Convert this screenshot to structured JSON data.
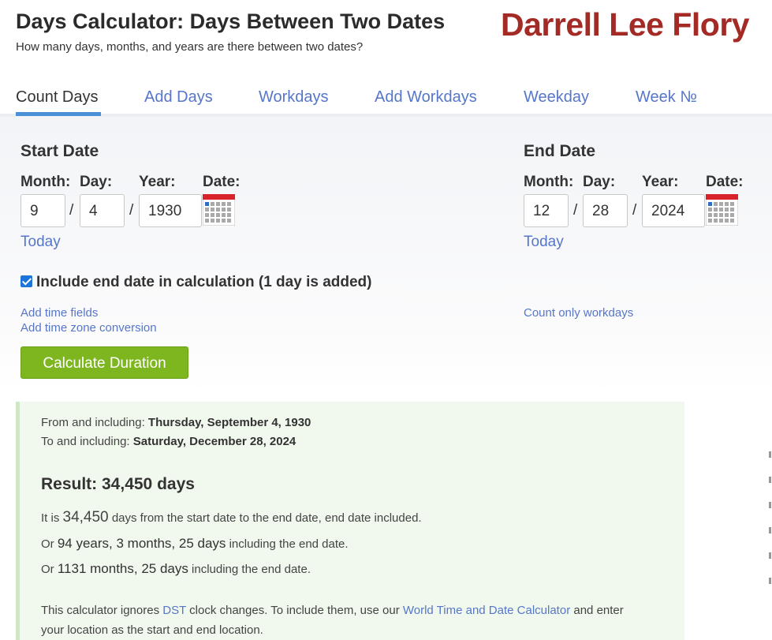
{
  "header": {
    "title": "Days Calculator: Days Between Two Dates",
    "subtitle": "How many days, months, and years are there between two dates?",
    "signature": "Darrell Lee Flory"
  },
  "tabs": [
    {
      "label": "Count Days",
      "active": true
    },
    {
      "label": "Add Days"
    },
    {
      "label": "Workdays"
    },
    {
      "label": "Add Workdays"
    },
    {
      "label": "Weekday"
    },
    {
      "label": "Week №"
    }
  ],
  "start": {
    "title": "Start Date",
    "month_label": "Month:",
    "day_label": "Day:",
    "year_label": "Year:",
    "date_label": "Date:",
    "month": "9",
    "day": "4",
    "year": "1930",
    "today": "Today"
  },
  "end": {
    "title": "End Date",
    "month_label": "Month:",
    "day_label": "Day:",
    "year_label": "Year:",
    "date_label": "Date:",
    "month": "12",
    "day": "28",
    "year": "2024",
    "today": "Today"
  },
  "options": {
    "include_end_date": "Include end date in calculation (1 day is added)",
    "include_end_checked": true,
    "add_time_fields": "Add time fields",
    "add_time_zone": "Add time zone conversion",
    "count_workdays": "Count only workdays"
  },
  "calculate_label": "Calculate Duration",
  "result": {
    "from_prefix": "From and including:",
    "from_date": "Thursday, September 4, 1930",
    "to_prefix": "To and including:",
    "to_date": "Saturday, December 28, 2024",
    "heading": "Result: 34,450 days",
    "line1_pre": "It is",
    "line1_num": "34,450",
    "line1_post": "days from the start date to the end date, end date included.",
    "line2_pre": "Or",
    "line2_num": "94 years, 3 months, 25 days",
    "line2_post": "including the end date.",
    "line3_pre": "Or",
    "line3_num": "1131 months, 25 days",
    "line3_post": "including the end date.",
    "dst_pre": "This calculator ignores",
    "dst_link": "DST",
    "dst_mid": "clock changes. To include them, use our",
    "dst_link2": "World Time and Date Calculator",
    "dst_post": "and enter",
    "dst_line2": "your location as the start and end location."
  },
  "colors": {
    "link": "#5676c9",
    "signature": "#a42a25",
    "button": "#7eb61f",
    "result_bg": "#f1f9ee",
    "tab_underline": "#4b8fd6"
  }
}
